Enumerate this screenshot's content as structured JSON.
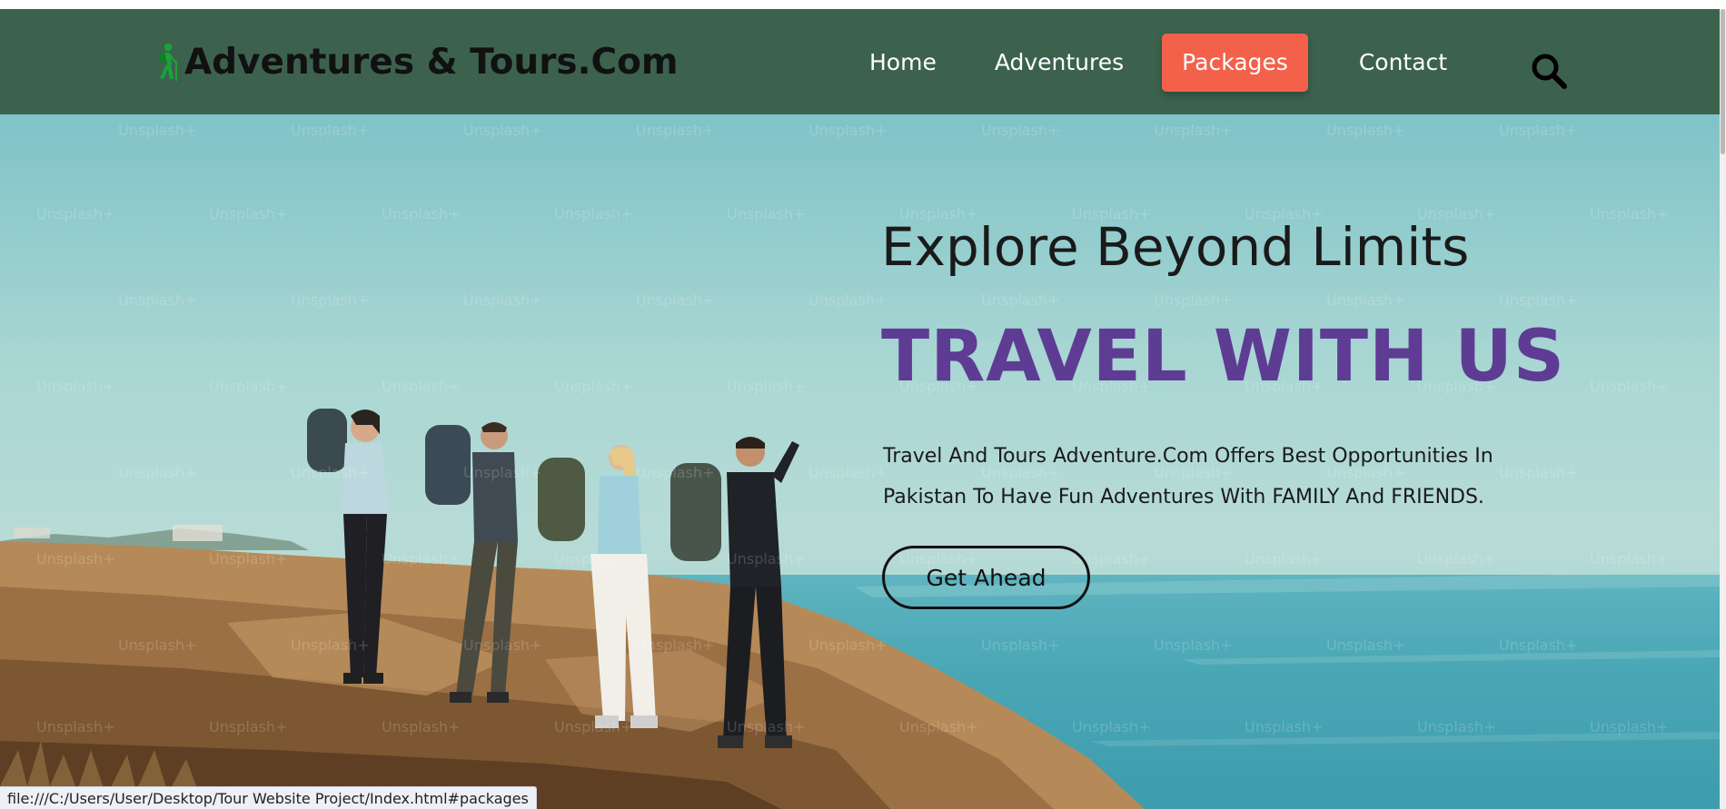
{
  "header": {
    "brand": "Adventures & Tours.Com",
    "nav": {
      "home": "Home",
      "adventures": "Adventures",
      "packages": "Packages",
      "contact": "Contact"
    },
    "active_nav": "Packages",
    "icons": [
      "hiker-icon",
      "search-icon"
    ],
    "colors": {
      "background": "#3c624e",
      "active": "#f4614a",
      "link": "#ffffff"
    }
  },
  "hero": {
    "title": "Explore Beyond Limits",
    "headline": "TRAVEL WITH US",
    "description": "Travel And Tours Adventure.Com Offers Best Opportunities In Pakistan To Have Fun Adventures With FAMILY And FRIENDS.",
    "cta_label": "Get Ahead",
    "watermark": "Unsplash+",
    "colors": {
      "headline": "#5e3c94",
      "text": "#1a1a1a"
    }
  },
  "status_bar": {
    "url": "file:///C:/Users/User/Desktop/Tour Website Project/Index.html#packages"
  }
}
